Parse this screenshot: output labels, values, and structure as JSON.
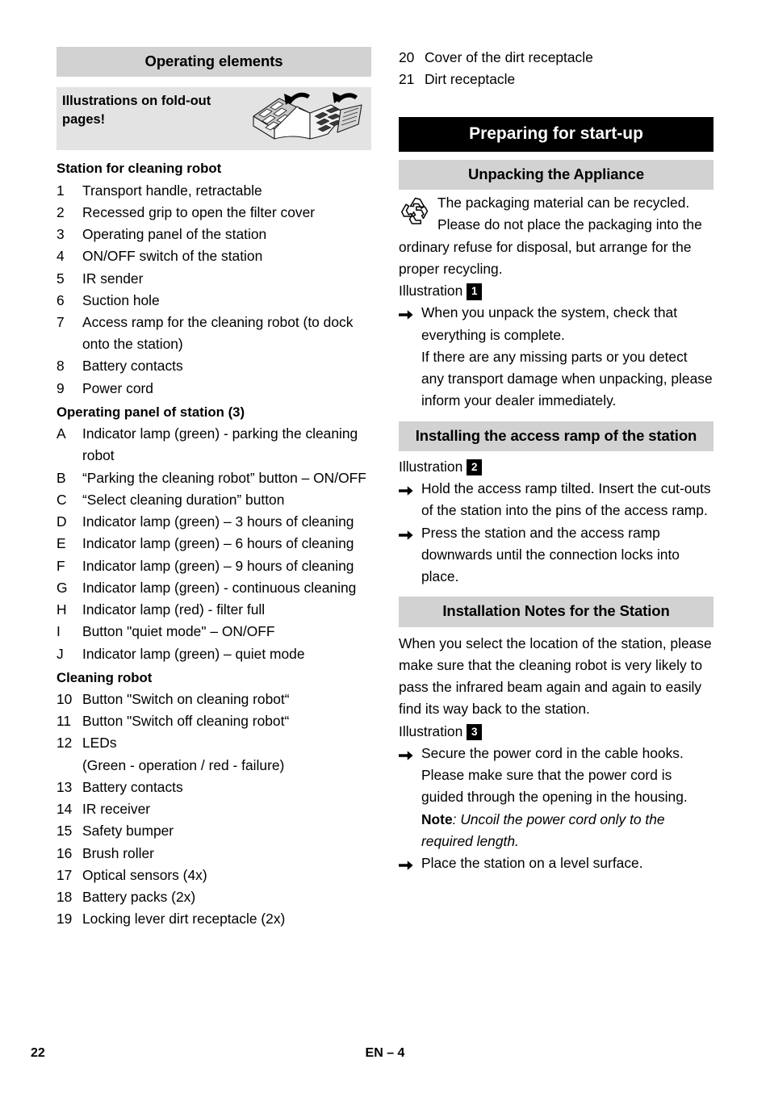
{
  "footer": {
    "page_number": "22",
    "section_ref": "EN – 4"
  },
  "left_column": {
    "section_title": "Operating elements",
    "foldout_notice": "Illustrations on fold-out pages!",
    "foldout_icon": "open-booklet-foldout-icon",
    "station_heading": "Station for cleaning robot",
    "station_items": [
      {
        "marker": "1",
        "text": "Transport handle, retractable"
      },
      {
        "marker": "2",
        "text": "Recessed grip to open the filter cover"
      },
      {
        "marker": "3",
        "text": "Operating panel of the station"
      },
      {
        "marker": "4",
        "text": "ON/OFF switch of the station"
      },
      {
        "marker": "5",
        "text": "IR sender"
      },
      {
        "marker": "6",
        "text": "Suction hole"
      },
      {
        "marker": "7",
        "text": "Access ramp for the cleaning robot (to dock onto the station)"
      },
      {
        "marker": "8",
        "text": "Battery contacts"
      },
      {
        "marker": "9",
        "text": "Power cord"
      }
    ],
    "panel_heading": "Operating panel of station (3)",
    "panel_items": [
      {
        "marker": "A",
        "text": "Indicator lamp (green) - parking the cleaning robot"
      },
      {
        "marker": "B",
        "text": "“Parking the cleaning robot” button – ON/OFF"
      },
      {
        "marker": "C",
        "text": "“Select cleaning duration” button"
      },
      {
        "marker": "D",
        "text": "Indicator lamp (green) – 3 hours of cleaning"
      },
      {
        "marker": "E",
        "text": "Indicator lamp (green) – 6 hours of cleaning"
      },
      {
        "marker": "F",
        "text": "Indicator lamp (green) – 9 hours of cleaning"
      },
      {
        "marker": "G",
        "text": "Indicator lamp (green) - continuous cleaning"
      },
      {
        "marker": "H",
        "text": "Indicator lamp (red) - filter full"
      },
      {
        "marker": "I",
        "text": "Button \"quiet mode\" – ON/OFF"
      },
      {
        "marker": "J",
        "text": "Indicator lamp (green) – quiet mode"
      }
    ],
    "robot_heading": "Cleaning robot",
    "robot_items": [
      {
        "marker": "10",
        "text": "Button \"Switch on cleaning robot“"
      },
      {
        "marker": "11",
        "text": "Button \"Switch off cleaning robot“"
      },
      {
        "marker": "12",
        "text": "LEDs"
      },
      {
        "marker": "",
        "text": "(Green - operation / red - failure)"
      },
      {
        "marker": "13",
        "text": "Battery contacts"
      },
      {
        "marker": "14",
        "text": "IR receiver"
      },
      {
        "marker": "15",
        "text": "Safety bumper"
      },
      {
        "marker": "16",
        "text": "Brush roller"
      },
      {
        "marker": "17",
        "text": "Optical sensors (4x)"
      },
      {
        "marker": "18",
        "text": "Battery packs (2x)"
      },
      {
        "marker": "19",
        "text": "Locking lever dirt receptacle (2x)"
      }
    ]
  },
  "right_column": {
    "continued_items": [
      {
        "marker": "20",
        "text": "Cover of the dirt receptacle"
      },
      {
        "marker": "21",
        "text": "Dirt receptacle"
      }
    ],
    "chapter_title": "Preparing for start-up",
    "unpacking": {
      "heading": "Unpacking the Appliance",
      "recycle_icon": "recycling-mobius-icon",
      "recycle_text": "The packaging material can be recycled. Please do not place the packaging into the ordinary refuse for disposal, but arrange for the proper recycling.",
      "illustration_label": "Illustration",
      "illustration_number": "1",
      "steps": [
        "When you unpack the system, check that everything is complete."
      ],
      "follow_up": "If there are any missing parts or you detect any transport damage when unpacking, please inform your dealer immediately."
    },
    "access_ramp": {
      "heading": "Installing the access ramp of the station",
      "illustration_label": "Illustration",
      "illustration_number": "2",
      "steps": [
        "Hold the access ramp tilted. Insert the cut-outs of the station into the pins of the access ramp.",
        "Press the station and the access ramp downwards until the connection locks into place."
      ]
    },
    "installation_notes": {
      "heading": "Installation Notes for the Station",
      "intro": "When you select the location of the station, please make sure that the cleaning robot is very likely to pass the infrared beam again and again to easily find its way back to the station.",
      "illustration_label": "Illustration",
      "illustration_number": "3",
      "step_one": "Secure the power cord in the cable hooks. Please make sure that the power cord is guided through the opening in the housing.",
      "note_label": "Note",
      "note_text": ": Uncoil the power cord only to the required length.",
      "step_two": "Place the station on a level surface."
    }
  },
  "colors": {
    "bar_gray": "#d2d2d2",
    "callout_gray": "#e3e3e3",
    "bar_black": "#000000",
    "text": "#000000",
    "page_background": "#ffffff"
  }
}
